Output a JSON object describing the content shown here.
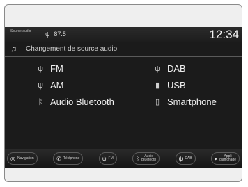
{
  "status": {
    "source_label": "Source audio",
    "frequency": "87.5",
    "clock": "12:34"
  },
  "header": {
    "title": "Changement de source audio"
  },
  "sources": {
    "fm": "FM",
    "am": "AM",
    "bluetooth": "Audio Bluetooth",
    "dab": "DAB",
    "usb": "USB",
    "smartphone": "Smartphone"
  },
  "bottom": {
    "navigation": "Navigation",
    "phone": "Téléphone",
    "fm": "FM",
    "bt_line1": "Audio",
    "bt_line2": "Bluetooth",
    "dab": "DAB",
    "apps_line1": "Appli",
    "apps_line2": "d'affichage"
  },
  "icons": {
    "music": "music-note-icon",
    "antenna": "antenna-icon",
    "bluetooth": "bluetooth-icon",
    "usb": "usb-icon",
    "smartphone": "smartphone-icon",
    "navigation": "navigation-icon",
    "phone": "phone-icon"
  }
}
